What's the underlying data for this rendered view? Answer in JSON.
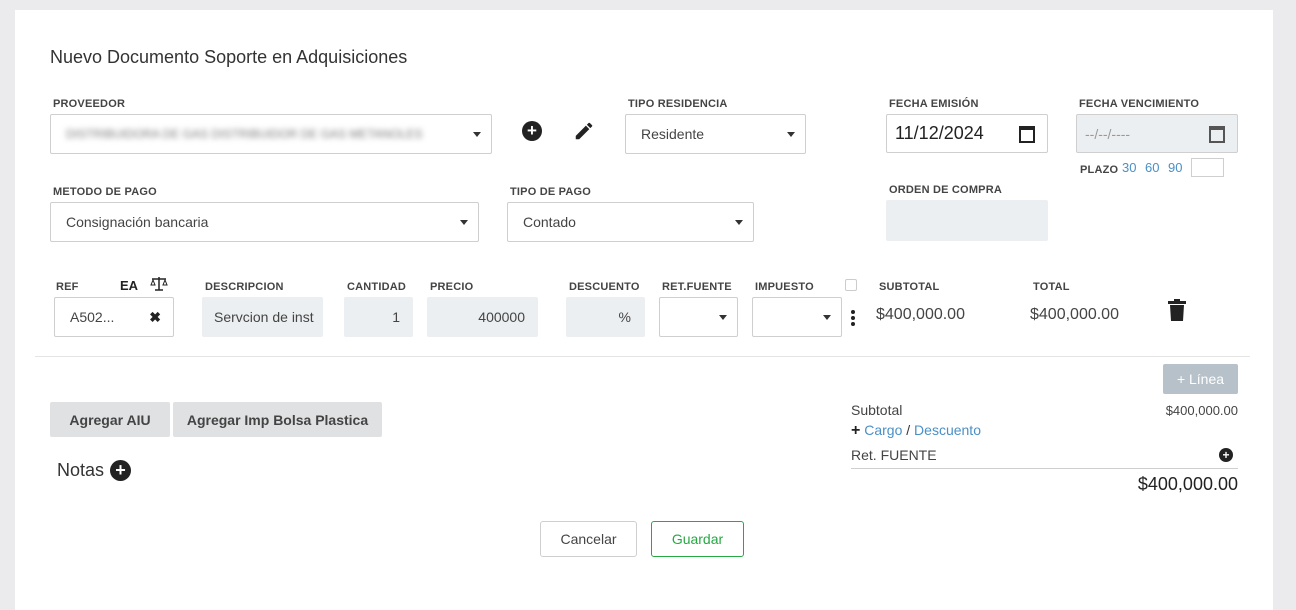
{
  "form": {
    "title": "Nuevo Documento Soporte en Adquisiciones",
    "proveedor": {
      "label": "PROVEEDOR",
      "value": "DISTRIBUIDORA DE GAS DISTRIBUIDOR DE GAS METANOLES"
    },
    "tipo_residencia": {
      "label": "TIPO RESIDENCIA",
      "value": "Residente"
    },
    "fecha_emision": {
      "label": "FECHA EMISIÓN",
      "value": "11/12/2024"
    },
    "fecha_vencimiento": {
      "label": "FECHA VENCIMIENTO",
      "placeholder": "--/--/----"
    },
    "plazo": {
      "label": "PLAZO",
      "options": [
        "30",
        "60",
        "90"
      ]
    },
    "metodo_pago": {
      "label": "METODO DE PAGO",
      "value": "Consignación bancaria"
    },
    "tipo_pago": {
      "label": "TIPO DE PAGO",
      "value": "Contado"
    },
    "orden_compra": {
      "label": "ORDEN DE COMPRA",
      "value": ""
    }
  },
  "lines": {
    "headers": {
      "ref": "REF",
      "ea": "EA",
      "descripcion": "DESCRIPCION",
      "cantidad": "CANTIDAD",
      "precio": "PRECIO",
      "descuento": "DESCUENTO",
      "ret_fuente": "RET.FUENTE",
      "impuesto": "IMPUESTO",
      "subtotal": "SUBTOTAL",
      "total": "TOTAL"
    },
    "row": {
      "ref": "A502...",
      "descripcion": "Servcion de inst",
      "cantidad": "1",
      "precio": "400000",
      "descuento_unit": "%",
      "subtotal": "$400,000.00",
      "total": "$400,000.00"
    },
    "add_line_label": "+ Línea"
  },
  "actions": {
    "agregar_aiu": "Agregar AIU",
    "agregar_bolsa": "Agregar Imp Bolsa Plastica",
    "notas": "Notas",
    "cancelar": "Cancelar",
    "guardar": "Guardar"
  },
  "totals": {
    "subtotal_label": "Subtotal",
    "subtotal_value": "$400,000.00",
    "cargo_label": "Cargo",
    "slash": "/",
    "descuento_label": "Descuento",
    "ret_label": "Ret. FUENTE",
    "grand_total": "$400,000.00"
  },
  "colors": {
    "accent": "#4a90c6",
    "success": "#28a745",
    "background": "#ebebee"
  }
}
